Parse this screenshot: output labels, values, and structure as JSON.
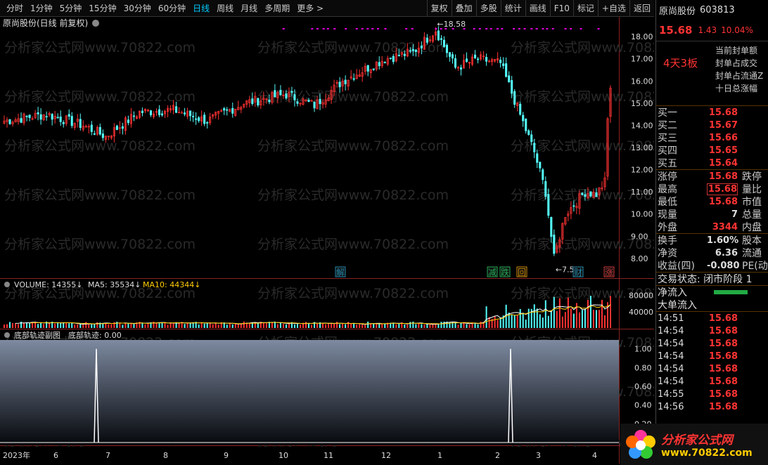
{
  "toolbar": {
    "timeframes": [
      "分时",
      "1分钟",
      "5分钟",
      "15分钟",
      "30分钟",
      "60分钟",
      "日线",
      "周线",
      "月线",
      "多周期",
      "更多 >"
    ],
    "active": "日线",
    "buttons": [
      "复权",
      "叠加",
      "多股",
      "统计",
      "画线",
      "F10",
      "标记",
      "+自选",
      "返回"
    ]
  },
  "chart": {
    "title": "原尚股份(日线 前复权)",
    "y_labels": [
      "18.00",
      "17.00",
      "16.00",
      "15.00",
      "14.00",
      "13.00",
      "12.00",
      "11.00",
      "10.00",
      "9.00",
      "8.00"
    ],
    "high_mark": "18.58",
    "low_mark": "7.50",
    "event_tags": [
      "解",
      "减",
      "跌",
      "回",
      "财",
      "涨"
    ],
    "watermark": "分析家公式网www.70822.com",
    "colors": {
      "up": "#ff3232",
      "down": "#54fcfc",
      "ma5": "#ffffff",
      "ma10": "#ffcc00",
      "accent": "#e000e0"
    }
  },
  "volume": {
    "label_volume": "VOLUME: 14355",
    "label_ma5": "MA5: 35534",
    "label_ma10": "MA10: 44344",
    "y_labels": [
      "80000",
      "40000"
    ]
  },
  "indicator": {
    "title": "底部轨迹副图",
    "value_label": "底部轨迹: 0.00",
    "y_labels": [
      "1.00",
      "0.80",
      "0.60",
      "0.40",
      "0.20"
    ]
  },
  "x_axis": {
    "labels": [
      "2023年",
      "6",
      "7",
      "8",
      "9",
      "10",
      "11",
      "12",
      "1",
      "2",
      "3",
      "4"
    ]
  },
  "chart_data": {
    "type": "candlestick",
    "ylim": [
      7.3,
      18.7
    ],
    "price_ticks": [
      18,
      17,
      16,
      15,
      14,
      13,
      12,
      11,
      10,
      9,
      8
    ],
    "months": [
      "2023年",
      "6",
      "7",
      "8",
      "9",
      "10",
      "11",
      "12",
      "1",
      "2",
      "3",
      "4"
    ],
    "volume_ylim": [
      0,
      95000
    ],
    "indicator_ylim": [
      0,
      1.05
    ],
    "indicator_spikes": [
      1,
      1
    ]
  },
  "quote": {
    "name": "原尚股份",
    "code": "603813",
    "price": "15.68",
    "change": "1.43",
    "change_pct": "10.04%",
    "board": "4天3板",
    "board_lines": [
      "当前封单额",
      "封单占成交",
      "封单占流通Z",
      "十日总涨幅"
    ],
    "asks": [
      {
        "label": "买一",
        "value": "15.68"
      },
      {
        "label": "买二",
        "value": "15.67"
      },
      {
        "label": "买三",
        "value": "15.66"
      },
      {
        "label": "买四",
        "value": "15.65"
      },
      {
        "label": "买五",
        "value": "15.64"
      }
    ],
    "stats": [
      {
        "label": "涨停",
        "value": "15.68",
        "extra": "跌停"
      },
      {
        "label": "最高",
        "value": "15.68",
        "extra": "量比"
      },
      {
        "label": "最低",
        "value": "15.68",
        "extra": "市值"
      },
      {
        "label": "现量",
        "value": "7",
        "extra": "总量"
      },
      {
        "label": "外盘",
        "value": "3344",
        "extra": "内盘"
      }
    ],
    "stats2": [
      {
        "label": "换手",
        "value": "1.60%",
        "extra": "股本"
      },
      {
        "label": "净资",
        "value": "6.36",
        "extra": "流通"
      },
      {
        "label": "收益(四)",
        "value": "-0.080",
        "extra": "PE(动"
      }
    ],
    "trade_status": "交易状态: 闭市阶段 1",
    "flow": [
      "净流入",
      "大单流入"
    ],
    "trades": [
      {
        "time": "14:51",
        "price": "15.68"
      },
      {
        "time": "14:54",
        "price": "15.68"
      },
      {
        "time": "14:54",
        "price": "15.68"
      },
      {
        "time": "14:54",
        "price": "15.68"
      },
      {
        "time": "14:54",
        "price": "15.68"
      },
      {
        "time": "14:54",
        "price": "15.68"
      },
      {
        "time": "14:55",
        "price": "15.68"
      },
      {
        "time": "14:56",
        "price": "15.68"
      }
    ]
  },
  "logo": {
    "line1": "分析家公式网",
    "line2": "www.70822.com"
  }
}
